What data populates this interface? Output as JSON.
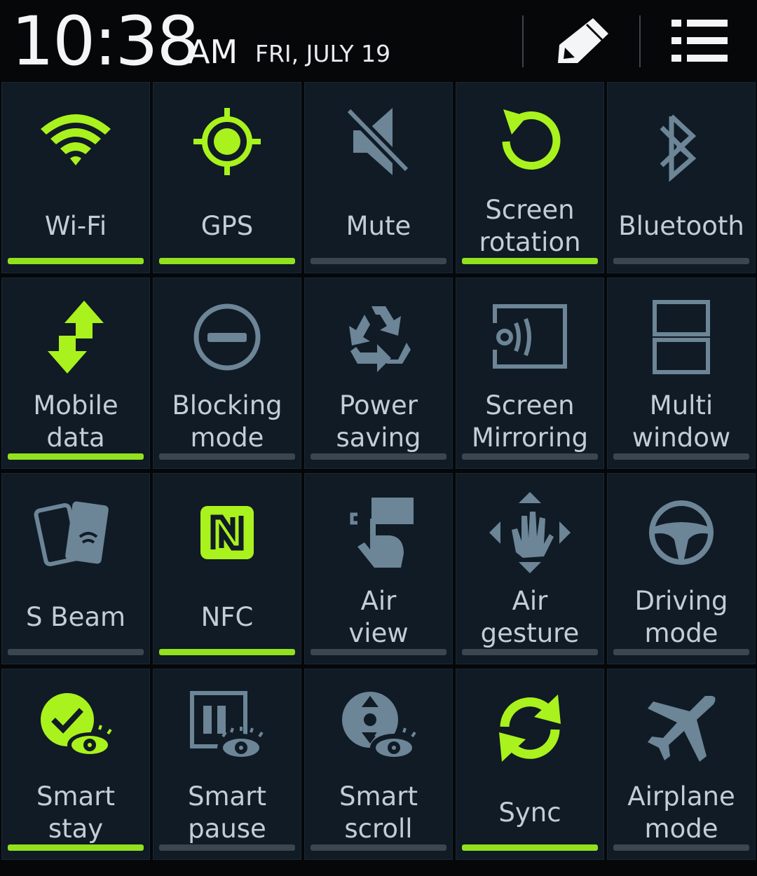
{
  "statusbar": {
    "time": "10:38",
    "ampm": "AM",
    "date": "FRI, JULY 19",
    "edit_icon": "pencil-icon",
    "menu_icon": "list-icon"
  },
  "colors": {
    "active": "#a9f21d",
    "inactive": "#6c8597",
    "bar_active": "#92e11e",
    "bar_inactive": "#3b4650",
    "tile_bg": "#101b25"
  },
  "tiles": [
    {
      "label": "Wi-Fi",
      "icon": "wifi-icon",
      "on": true
    },
    {
      "label": "GPS",
      "icon": "gps-icon",
      "on": true
    },
    {
      "label": "Mute",
      "icon": "mute-icon",
      "on": false
    },
    {
      "label": "Screen\nrotation",
      "icon": "rotation-icon",
      "on": true
    },
    {
      "label": "Bluetooth",
      "icon": "bluetooth-icon",
      "on": false
    },
    {
      "label": "Mobile\ndata",
      "icon": "mobile-data-icon",
      "on": true
    },
    {
      "label": "Blocking\nmode",
      "icon": "blocking-icon",
      "on": false
    },
    {
      "label": "Power\nsaving",
      "icon": "recycle-icon",
      "on": false
    },
    {
      "label": "Screen\nMirroring",
      "icon": "mirroring-icon",
      "on": false
    },
    {
      "label": "Multi\nwindow",
      "icon": "multi-window-icon",
      "on": false
    },
    {
      "label": "S Beam",
      "icon": "s-beam-icon",
      "on": false
    },
    {
      "label": "NFC",
      "icon": "nfc-icon",
      "on": true
    },
    {
      "label": "Air\nview",
      "icon": "air-view-icon",
      "on": false
    },
    {
      "label": "Air\ngesture",
      "icon": "air-gesture-icon",
      "on": false
    },
    {
      "label": "Driving\nmode",
      "icon": "steering-wheel-icon",
      "on": false
    },
    {
      "label": "Smart\nstay",
      "icon": "smart-stay-icon",
      "on": true
    },
    {
      "label": "Smart\npause",
      "icon": "smart-pause-icon",
      "on": false
    },
    {
      "label": "Smart\nscroll",
      "icon": "smart-scroll-icon",
      "on": false
    },
    {
      "label": "Sync",
      "icon": "sync-icon",
      "on": true
    },
    {
      "label": "Airplane\nmode",
      "icon": "airplane-icon",
      "on": false
    }
  ]
}
